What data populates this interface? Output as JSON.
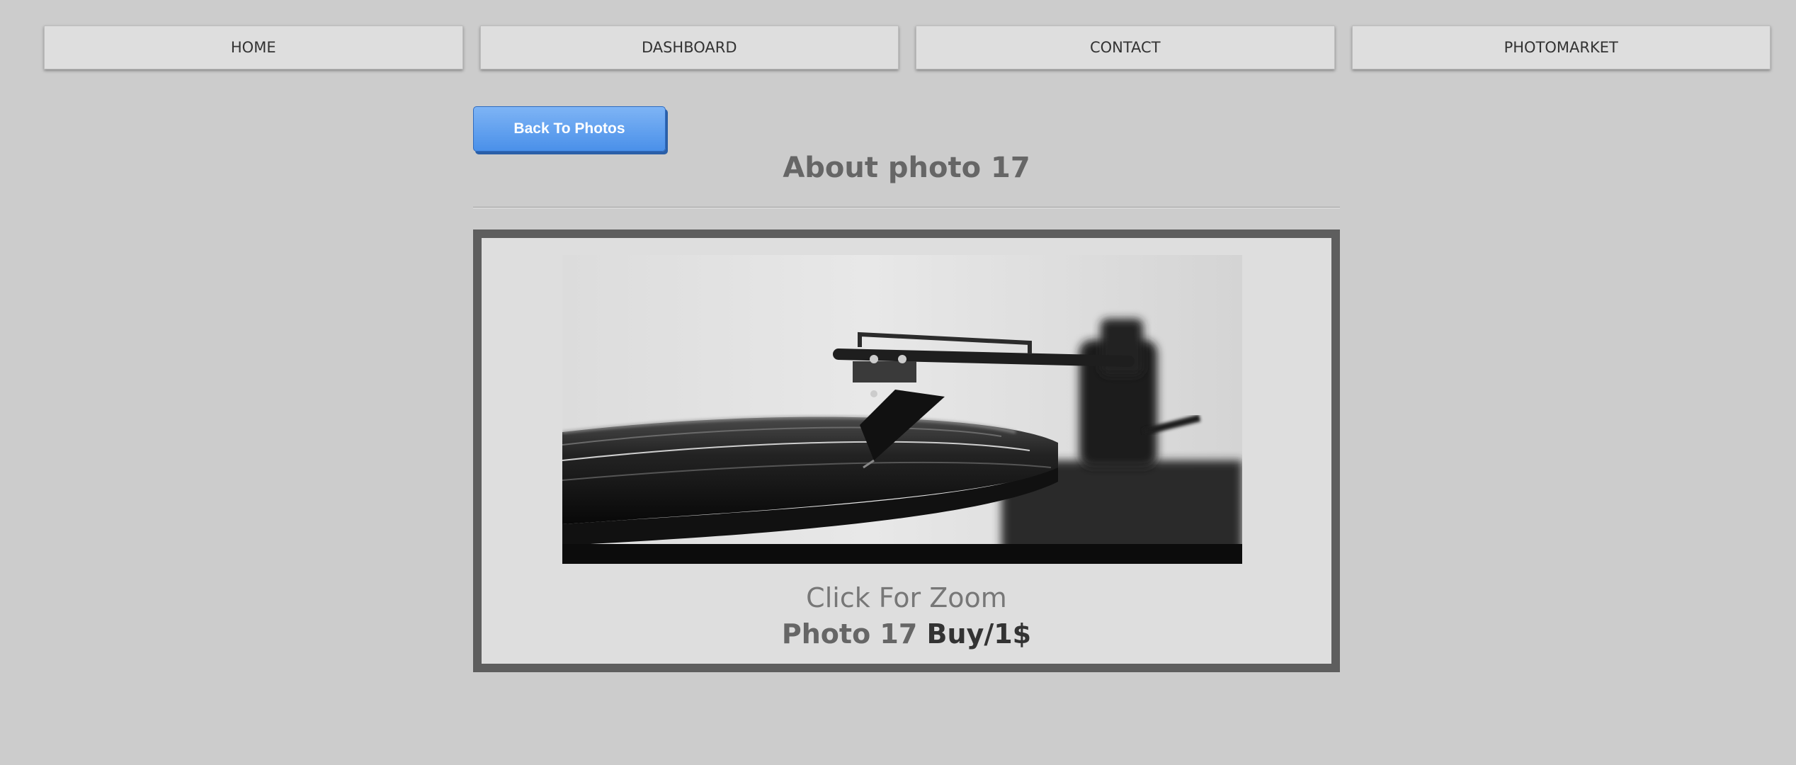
{
  "nav": {
    "items": [
      {
        "label": "HOME"
      },
      {
        "label": "DASHBOARD"
      },
      {
        "label": "CONTACT"
      },
      {
        "label": "PHOTOMARKET"
      }
    ]
  },
  "back_button": {
    "label": "Back To Photos"
  },
  "page_title": "About photo 17",
  "photo": {
    "subject": "turntable-tonearm-on-vinyl-record",
    "zoom_hint": "Click For Zoom",
    "name": "Photo 17",
    "buy_label": "Buy/1$"
  },
  "colors": {
    "background": "#cccccc",
    "card_border": "#5e5e5e",
    "button_blue": "#4a90e9"
  }
}
